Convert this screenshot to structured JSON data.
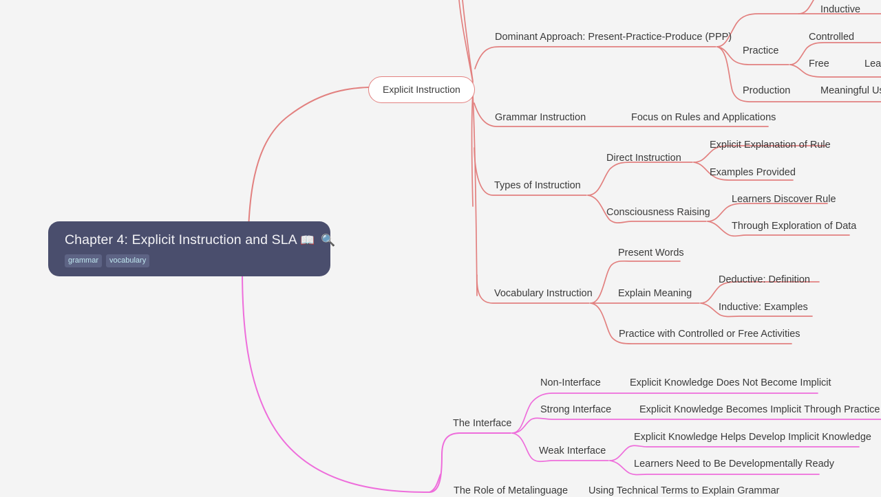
{
  "document": {
    "type": "mindmap",
    "background_color": "#f4f4f4",
    "branch_colors": {
      "explicit_instruction": "#e2807f",
      "interface": "#ee6ddb"
    }
  },
  "root": {
    "title": "Chapter 4: Explicit Instruction and SLA",
    "emojis": "📖 🔍",
    "tags": [
      "grammar",
      "vocabulary"
    ],
    "background_color": "#4a4e6d",
    "text_color": "#f2f2f5",
    "tag_background": "#5d6384",
    "tag_text_color": "#bfe6ef"
  },
  "branches": [
    {
      "id": "explicit-instruction",
      "label": "Explicit Instruction",
      "color": "#e2807f",
      "children": [
        {
          "label": "Dominant Approach: Present-Practice-Produce (PPP)",
          "children": [
            {
              "label": "Inductive"
            },
            {
              "label": "Practice",
              "children": [
                {
                  "label": "Controlled"
                },
                {
                  "label": "Free",
                  "children": [
                    {
                      "label": "Learn"
                    }
                  ]
                }
              ]
            },
            {
              "label": "Production",
              "children": [
                {
                  "label": "Meaningful Us"
                }
              ]
            }
          ]
        },
        {
          "label": "Grammar Instruction",
          "children": [
            {
              "label": "Focus on Rules and Applications"
            }
          ]
        },
        {
          "label": "Types of Instruction",
          "children": [
            {
              "label": "Direct Instruction",
              "children": [
                {
                  "label": "Explicit Explanation of Rule"
                },
                {
                  "label": "Examples Provided"
                }
              ]
            },
            {
              "label": "Consciousness Raising",
              "children": [
                {
                  "label": "Learners Discover Rule"
                },
                {
                  "label": "Through Exploration of Data"
                }
              ]
            }
          ]
        },
        {
          "label": "Vocabulary Instruction",
          "children": [
            {
              "label": "Present Words"
            },
            {
              "label": "Explain Meaning",
              "children": [
                {
                  "label": "Deductive: Definition"
                },
                {
                  "label": "Inductive: Examples"
                }
              ]
            },
            {
              "label": "Practice with Controlled or Free Activities"
            }
          ]
        }
      ]
    },
    {
      "id": "the-interface",
      "label": "The Interface",
      "color": "#ee6ddb",
      "children": [
        {
          "label": "Non-Interface",
          "children": [
            {
              "label": "Explicit Knowledge Does Not Become Implicit"
            }
          ]
        },
        {
          "label": "Strong Interface",
          "children": [
            {
              "label": "Explicit Knowledge Becomes Implicit Through Practice"
            }
          ]
        },
        {
          "label": "Weak Interface",
          "children": [
            {
              "label": "Explicit Knowledge Helps Develop Implicit Knowledge"
            },
            {
              "label": "Learners Need to Be Developmentally Ready"
            }
          ]
        }
      ]
    },
    {
      "id": "role-of-metalinguage",
      "label": "The Role of Metalinguage",
      "color": "#ee6ddb",
      "children": [
        {
          "label": "Using Technical Terms to Explain Grammar"
        }
      ]
    }
  ],
  "nodes": {
    "explicit_instruction": "Explicit Instruction",
    "ppp": "Dominant Approach: Present-Practice-Produce (PPP)",
    "inductive": "Inductive",
    "practice": "Practice",
    "controlled": "Controlled",
    "free": "Free",
    "learn_cut": "Learn",
    "production": "Production",
    "meaningful_use_cut": "Meaningful Us",
    "grammar_instruction": "Grammar Instruction",
    "focus_rules": "Focus on Rules and Applications",
    "types_of_instruction": "Types of Instruction",
    "direct_instruction": "Direct Instruction",
    "explicit_explanation": "Explicit Explanation of Rule",
    "examples_provided": "Examples Provided",
    "consciousness_raising": "Consciousness Raising",
    "learners_discover": "Learners Discover Rule",
    "through_exploration": "Through Exploration of Data",
    "vocabulary_instruction": "Vocabulary Instruction",
    "present_words": "Present Words",
    "explain_meaning": "Explain Meaning",
    "deductive_definition": "Deductive: Definition",
    "inductive_examples": "Inductive: Examples",
    "practice_activities": "Practice with Controlled or Free Activities",
    "the_interface": "The Interface",
    "non_interface": "Non-Interface",
    "non_interface_detail": "Explicit Knowledge Does Not Become Implicit",
    "strong_interface": "Strong Interface",
    "strong_interface_detail": "Explicit Knowledge Becomes Implicit Through Practice",
    "weak_interface": "Weak Interface",
    "weak_interface_detail_1": "Explicit Knowledge Helps Develop Implicit Knowledge",
    "weak_interface_detail_2": "Learners Need to Be Developmentally Ready",
    "role_metalinguage": "The Role of Metalinguage",
    "metalinguage_detail": "Using Technical Terms to Explain Grammar"
  }
}
